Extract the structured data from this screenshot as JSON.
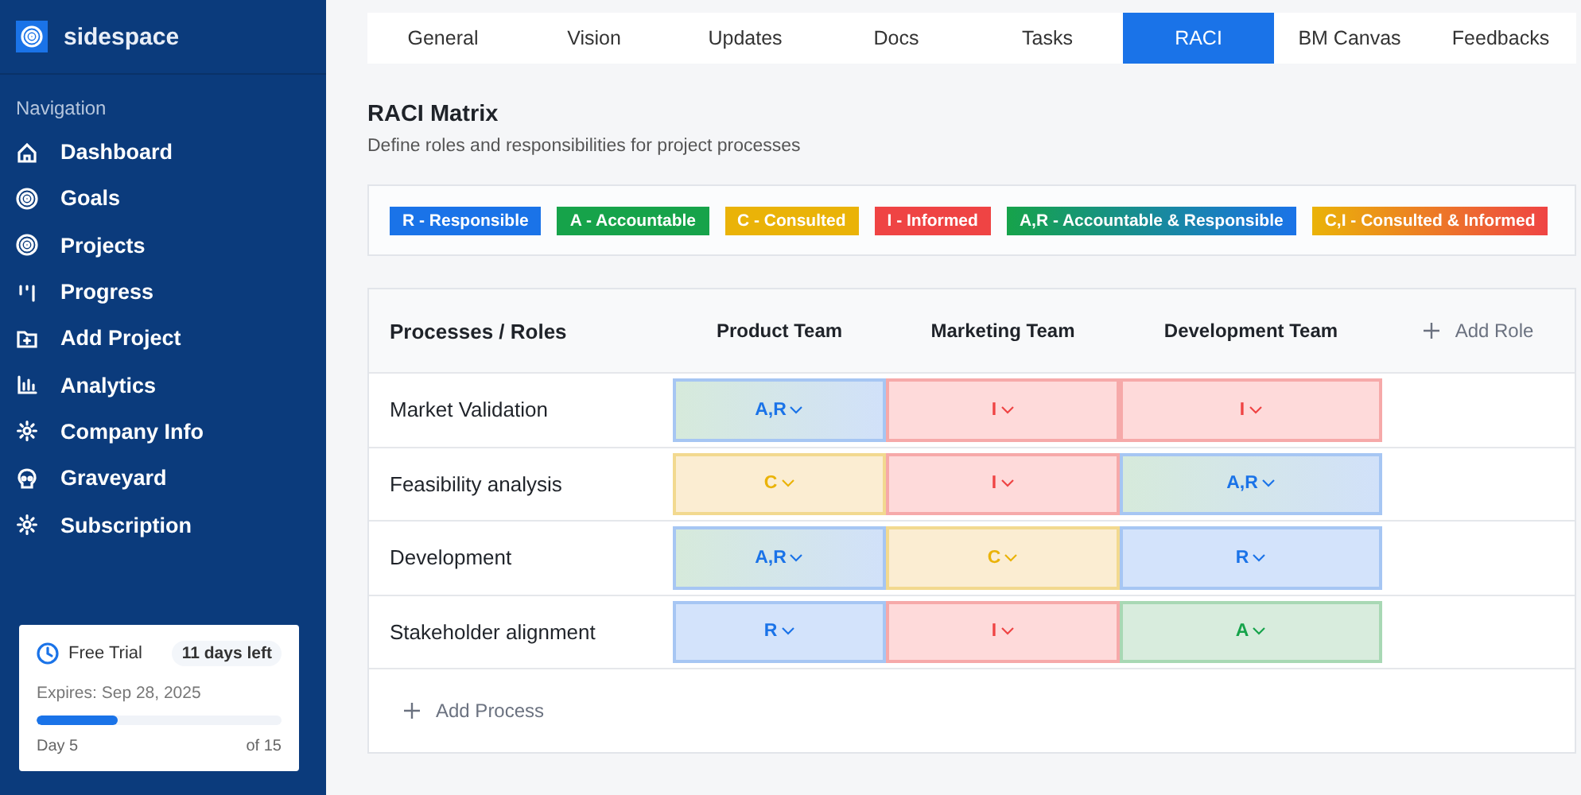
{
  "sidebar": {
    "brand": "sidespace",
    "section_title": "Navigation",
    "items": [
      {
        "label": "Dashboard",
        "kind": "home"
      },
      {
        "label": "Goals",
        "kind": "target"
      },
      {
        "label": "Projects",
        "kind": "target"
      },
      {
        "label": "Progress",
        "kind": "bars"
      },
      {
        "label": "Add Project",
        "kind": "folder"
      },
      {
        "label": "Analytics",
        "kind": "chart"
      },
      {
        "label": "Company Info",
        "kind": "gear"
      },
      {
        "label": "Graveyard",
        "kind": "skull"
      },
      {
        "label": "Subscription",
        "kind": "gear"
      }
    ],
    "trial": {
      "title": "Free Trial",
      "badge": "11 days left",
      "expires": "Expires: Sep 28, 2025",
      "level": 0.33,
      "day": "Day 5",
      "total": "of 15"
    }
  },
  "tabs": [
    {
      "label": "General",
      "selected": false
    },
    {
      "label": "Vision",
      "selected": false
    },
    {
      "label": "Updates",
      "selected": false
    },
    {
      "label": "Docs",
      "selected": false
    },
    {
      "label": "Tasks",
      "selected": false
    },
    {
      "label": "RACI",
      "selected": true
    },
    {
      "label": "BM Canvas",
      "selected": false
    },
    {
      "label": "Feedbacks",
      "selected": false
    }
  ],
  "page": {
    "title": "RACI Matrix",
    "subtitle": "Define roles and responsibilities for project processes"
  },
  "legend": [
    {
      "label": "R - Responsible",
      "kind": "responsible"
    },
    {
      "label": "A - Accountable",
      "kind": "accountable"
    },
    {
      "label": "C - Consulted",
      "kind": "consulted"
    },
    {
      "label": "I - Informed",
      "kind": "informed"
    },
    {
      "label": "A,R - Accountable & Responsible",
      "kind": "accountable_responsible"
    },
    {
      "label": "C,I - Consulted & Informed",
      "kind": "consulted_informed"
    }
  ],
  "matrix": {
    "corner": "Processes / Roles",
    "roles": [
      "Product Team",
      "Marketing Team",
      "Development Team"
    ],
    "add_role": "Add Role",
    "add_process": "Add Process",
    "rows": [
      {
        "process": "Market Validation",
        "cells": [
          {
            "label": "A,R",
            "kind": "accountable_responsible"
          },
          {
            "label": "I",
            "kind": "informed"
          },
          {
            "label": "I",
            "kind": "informed"
          }
        ]
      },
      {
        "process": "Feasibility analysis",
        "cells": [
          {
            "label": "C",
            "kind": "consulted"
          },
          {
            "label": "I",
            "kind": "informed"
          },
          {
            "label": "A,R",
            "kind": "accountable_responsible"
          }
        ]
      },
      {
        "process": "Development",
        "cells": [
          {
            "label": "A,R",
            "kind": "accountable_responsible"
          },
          {
            "label": "C",
            "kind": "consulted"
          },
          {
            "label": "R",
            "kind": "responsible"
          }
        ]
      },
      {
        "process": "Stakeholder alignment",
        "cells": [
          {
            "label": "R",
            "kind": "responsible"
          },
          {
            "label": "I",
            "kind": "informed"
          },
          {
            "label": "A",
            "kind": "accountable"
          }
        ]
      }
    ]
  }
}
